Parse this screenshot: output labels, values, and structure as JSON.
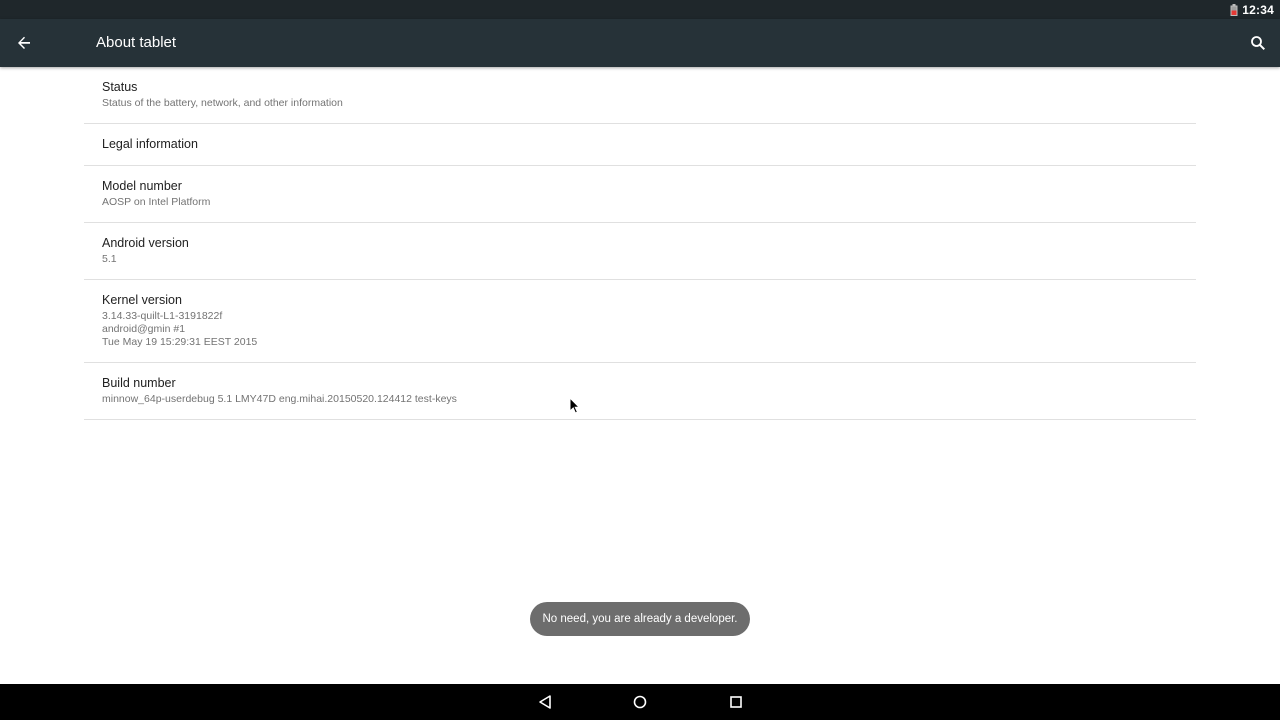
{
  "status_bar": {
    "time": "12:34",
    "icons": [
      "battery-icon"
    ]
  },
  "app_bar": {
    "title": "About tablet",
    "icons": [
      "back-arrow-icon",
      "search-icon"
    ]
  },
  "settings": [
    {
      "title": "Status",
      "summary": "Status of the battery, network, and other information"
    },
    {
      "title": "Legal information",
      "summary": ""
    },
    {
      "title": "Model number",
      "summary": "AOSP on Intel Platform"
    },
    {
      "title": "Android version",
      "summary": "5.1"
    },
    {
      "title": "Kernel version",
      "summary": "3.14.33-quilt-L1-3191822f\nandroid@gmin #1\nTue May 19 15:29:31 EEST 2015"
    },
    {
      "title": "Build number",
      "summary": "minnow_64p-userdebug 5.1 LMY47D eng.mihai.20150520.124412 test-keys"
    }
  ],
  "toast": {
    "message": "No need, you are already a developer."
  },
  "nav_bar": {
    "icons": [
      "nav-back-icon",
      "nav-home-icon",
      "nav-recents-icon"
    ]
  },
  "colors": {
    "status_bar": "#1f272b",
    "app_bar": "#263238",
    "divider": "#e0e0e0",
    "toast": "#6d6d6d",
    "nav_bar": "#000000"
  }
}
